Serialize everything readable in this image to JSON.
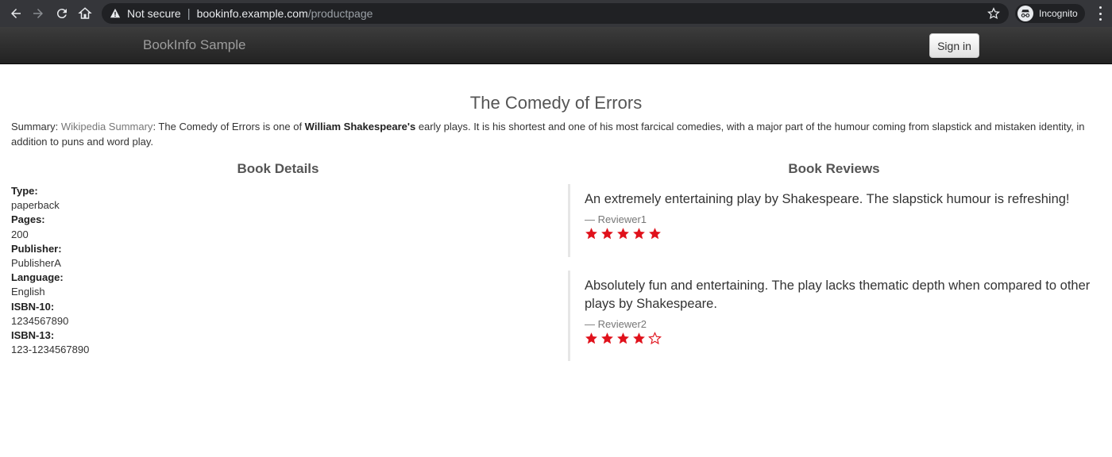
{
  "browser": {
    "security_label": "Not secure",
    "url_host": "bookinfo.example.com",
    "url_path": "/productpage",
    "incognito_label": "Incognito"
  },
  "navbar": {
    "brand": "BookInfo Sample",
    "signin_label": "Sign in"
  },
  "book": {
    "title": "The Comedy of Errors",
    "summary_prefix": "Summary: ",
    "summary_link": "Wikipedia Summary",
    "summary_mid": ": The Comedy of Errors is one of ",
    "summary_bold": "William Shakespeare's",
    "summary_rest": " early plays. It is his shortest and one of his most farcical comedies, with a major part of the humour coming from slapstick and mistaken identity, in addition to puns and word play."
  },
  "details": {
    "heading": "Book Details",
    "fields": [
      {
        "label": "Type:",
        "value": "paperback"
      },
      {
        "label": "Pages:",
        "value": "200"
      },
      {
        "label": "Publisher:",
        "value": "PublisherA"
      },
      {
        "label": "Language:",
        "value": "English"
      },
      {
        "label": "ISBN-10:",
        "value": "1234567890"
      },
      {
        "label": "ISBN-13:",
        "value": "123-1234567890"
      }
    ]
  },
  "reviews": {
    "heading": "Book Reviews",
    "star_color": "#e0111b",
    "items": [
      {
        "text": "An extremely entertaining play by Shakespeare. The slapstick humour is refreshing!",
        "reviewer": "— Reviewer1",
        "rating": 5,
        "max": 5
      },
      {
        "text": "Absolutely fun and entertaining. The play lacks thematic depth when compared to other plays by Shakespeare.",
        "reviewer": "— Reviewer2",
        "rating": 4,
        "max": 5
      }
    ]
  }
}
